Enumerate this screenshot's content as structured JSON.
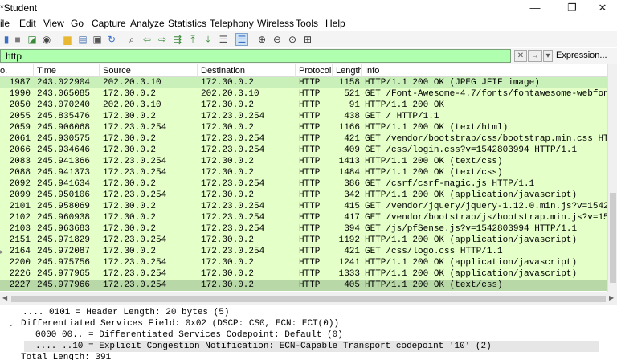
{
  "window": {
    "title": "*Student",
    "minimize": "—",
    "maximize": "❐",
    "close": "✕"
  },
  "menu": [
    "ile",
    "Edit",
    "View",
    "Go",
    "Capture",
    "Analyze",
    "Statistics",
    "Telephony",
    "Wireless",
    "Tools",
    "Help"
  ],
  "toolbar_icons": [
    {
      "name": "start-capture-icon",
      "glyph": "▮",
      "color": "#3a6fc4"
    },
    {
      "name": "stop-capture-icon",
      "glyph": "■",
      "color": "#7a7a7a"
    },
    {
      "name": "restart-capture-icon",
      "glyph": "◪",
      "color": "#3a8a3a"
    },
    {
      "name": "capture-options-icon",
      "glyph": "◉",
      "color": "#444444"
    },
    {
      "name": "open-file-icon",
      "glyph": "▆",
      "color": "#e8b833"
    },
    {
      "name": "save-file-icon",
      "glyph": "▤",
      "color": "#5a7fb8"
    },
    {
      "name": "close-file-icon",
      "glyph": "▣",
      "color": "#555555"
    },
    {
      "name": "reload-file-icon",
      "glyph": "↻",
      "color": "#3a6fc4"
    },
    {
      "name": "find-packet-icon",
      "glyph": "⌕",
      "color": "#333333"
    },
    {
      "name": "go-back-icon",
      "glyph": "⇦",
      "color": "#3a8a3a"
    },
    {
      "name": "go-forward-icon",
      "glyph": "⇨",
      "color": "#3a8a3a"
    },
    {
      "name": "go-to-packet-icon",
      "glyph": "⇶",
      "color": "#3a8a3a"
    },
    {
      "name": "go-first-packet-icon",
      "glyph": "⤒",
      "color": "#3a8a3a"
    },
    {
      "name": "go-last-packet-icon",
      "glyph": "⤓",
      "color": "#3a8a3a"
    },
    {
      "name": "autoscroll-icon",
      "glyph": "☰",
      "color": "#555555"
    },
    {
      "name": "colorize-icon",
      "glyph": "☰",
      "color": "#3a6fc4"
    },
    {
      "name": "zoom-in-icon",
      "glyph": "⊕",
      "color": "#333333"
    },
    {
      "name": "zoom-out-icon",
      "glyph": "⊖",
      "color": "#333333"
    },
    {
      "name": "zoom-normal-icon",
      "glyph": "⊙",
      "color": "#333333"
    },
    {
      "name": "resize-columns-icon",
      "glyph": "⊞",
      "color": "#333333"
    }
  ],
  "filter": {
    "value": "http",
    "clear_glyph": "✕",
    "apply_glyph": "→",
    "dropdown_glyph": "▾",
    "expression_label": "Expression..."
  },
  "columns": [
    "o.",
    "Time",
    "Source",
    "Destination",
    "Protocol",
    "Length",
    "Info"
  ],
  "packets": [
    {
      "no": "1987",
      "time": "243.022904",
      "src": "202.20.3.10",
      "dst": "172.30.0.2",
      "proto": "HTTP",
      "len": "1158",
      "info": "HTTP/1.1 200 OK  (JPEG JFIF image)",
      "state": "selected"
    },
    {
      "no": "1990",
      "time": "243.065085",
      "src": "172.30.0.2",
      "dst": "202.20.3.10",
      "proto": "HTTP",
      "len": "521",
      "info": "GET /Font-Awesome-4.7/fonts/fontawesome-webfont.w",
      "state": ""
    },
    {
      "no": "2050",
      "time": "243.070240",
      "src": "202.20.3.10",
      "dst": "172.30.0.2",
      "proto": "HTTP",
      "len": "91",
      "info": "HTTP/1.1 200 OK",
      "state": ""
    },
    {
      "no": "2055",
      "time": "245.835476",
      "src": "172.30.0.2",
      "dst": "172.23.0.254",
      "proto": "HTTP",
      "len": "438",
      "info": "GET / HTTP/1.1",
      "state": ""
    },
    {
      "no": "2059",
      "time": "245.906068",
      "src": "172.23.0.254",
      "dst": "172.30.0.2",
      "proto": "HTTP",
      "len": "1166",
      "info": "HTTP/1.1 200 OK  (text/html)",
      "state": ""
    },
    {
      "no": "2061",
      "time": "245.930575",
      "src": "172.30.0.2",
      "dst": "172.23.0.254",
      "proto": "HTTP",
      "len": "421",
      "info": "GET /vendor/bootstrap/css/bootstrap.min.css HTTP/",
      "state": ""
    },
    {
      "no": "2066",
      "time": "245.934646",
      "src": "172.30.0.2",
      "dst": "172.23.0.254",
      "proto": "HTTP",
      "len": "409",
      "info": "GET /css/login.css?v=1542803994 HTTP/1.1",
      "state": ""
    },
    {
      "no": "2083",
      "time": "245.941366",
      "src": "172.23.0.254",
      "dst": "172.30.0.2",
      "proto": "HTTP",
      "len": "1413",
      "info": "HTTP/1.1 200 OK  (text/css)",
      "state": ""
    },
    {
      "no": "2088",
      "time": "245.941373",
      "src": "172.23.0.254",
      "dst": "172.30.0.2",
      "proto": "HTTP",
      "len": "1484",
      "info": "HTTP/1.1 200 OK  (text/css)",
      "state": ""
    },
    {
      "no": "2092",
      "time": "245.941634",
      "src": "172.30.0.2",
      "dst": "172.23.0.254",
      "proto": "HTTP",
      "len": "386",
      "info": "GET /csrf/csrf-magic.js HTTP/1.1",
      "state": ""
    },
    {
      "no": "2099",
      "time": "245.950106",
      "src": "172.23.0.254",
      "dst": "172.30.0.2",
      "proto": "HTTP",
      "len": "342",
      "info": "HTTP/1.1 200 OK  (application/javascript)",
      "state": ""
    },
    {
      "no": "2101",
      "time": "245.958069",
      "src": "172.30.0.2",
      "dst": "172.23.0.254",
      "proto": "HTTP",
      "len": "415",
      "info": "GET /vendor/jquery/jquery-1.12.0.min.js?v=1542803",
      "state": ""
    },
    {
      "no": "2102",
      "time": "245.960938",
      "src": "172.30.0.2",
      "dst": "172.23.0.254",
      "proto": "HTTP",
      "len": "417",
      "info": "GET /vendor/bootstrap/js/bootstrap.min.js?v=15428",
      "state": ""
    },
    {
      "no": "2103",
      "time": "245.963683",
      "src": "172.30.0.2",
      "dst": "172.23.0.254",
      "proto": "HTTP",
      "len": "394",
      "info": "GET /js/pfSense.js?v=1542803994 HTTP/1.1",
      "state": ""
    },
    {
      "no": "2151",
      "time": "245.971829",
      "src": "172.23.0.254",
      "dst": "172.30.0.2",
      "proto": "HTTP",
      "len": "1192",
      "info": "HTTP/1.1 200 OK  (application/javascript)",
      "state": ""
    },
    {
      "no": "2164",
      "time": "245.972087",
      "src": "172.30.0.2",
      "dst": "172.23.0.254",
      "proto": "HTTP",
      "len": "421",
      "info": "GET /css/logo.css HTTP/1.1",
      "state": "",
      "arrow": "▸"
    },
    {
      "no": "2200",
      "time": "245.975756",
      "src": "172.23.0.254",
      "dst": "172.30.0.2",
      "proto": "HTTP",
      "len": "1241",
      "info": "HTTP/1.1 200 OK  (application/javascript)",
      "state": ""
    },
    {
      "no": "2226",
      "time": "245.977965",
      "src": "172.23.0.254",
      "dst": "172.30.0.2",
      "proto": "HTTP",
      "len": "1333",
      "info": "HTTP/1.1 200 OK  (application/javascript)",
      "state": ""
    },
    {
      "no": "2227",
      "time": "245.977966",
      "src": "172.23.0.254",
      "dst": "172.30.0.2",
      "proto": "HTTP",
      "len": "405",
      "info": "HTTP/1.1 200 OK  (text/css)",
      "state": "cut"
    }
  ],
  "details": [
    {
      "text": ".... 0101 = Header Length: 20 bytes (5)",
      "expander": "",
      "hl": false
    },
    {
      "text": "Differentiated Services Field: 0x02 (DSCP: CS0, ECN: ECT(0))",
      "expander": "⌄",
      "hl": false
    },
    {
      "text": "0000 00.. = Differentiated Services Codepoint: Default (0)",
      "expander": "",
      "hl": false
    },
    {
      "text": ".... ..10 = Explicit Congestion Notification: ECN-Capable Transport codepoint '10' (2)",
      "expander": "",
      "hl": true
    },
    {
      "text": "Total Length: 391",
      "expander": "",
      "hl": false
    }
  ],
  "colors": {
    "row_bg": "#e4ffc7",
    "selected_row_bg": "#c8f0b8",
    "filter_ok_bg": "#afffaf"
  }
}
